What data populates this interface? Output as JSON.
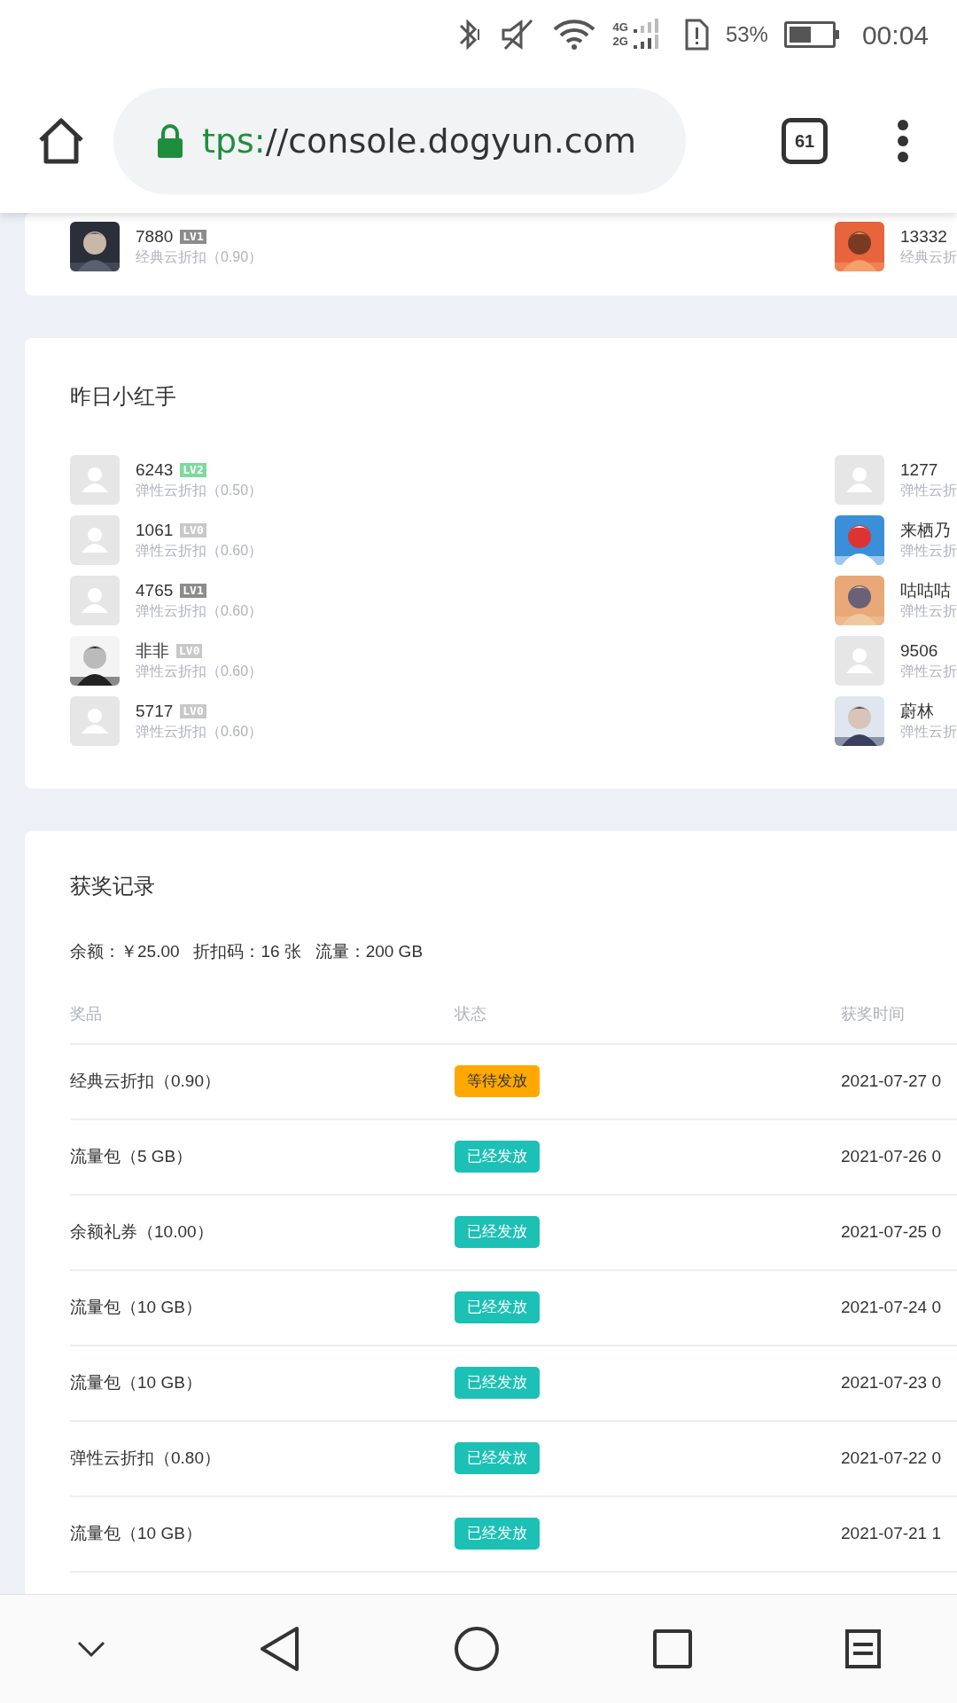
{
  "status_bar": {
    "network_top": "4G",
    "network_bottom": "2G",
    "battery": "53%",
    "time": "00:04"
  },
  "browser": {
    "url_scheme": "tps:",
    "url_rest": "//console.dogyun.com",
    "tab_count": "61"
  },
  "top_card": {
    "left": {
      "name": "7880",
      "badge": "LV1",
      "color": "#8c8c8c",
      "discount": "经典云折扣（0.90）",
      "kind": "picture"
    },
    "right": {
      "name": "13332",
      "discount": "经典云折",
      "kind": "picture"
    }
  },
  "helpers": {
    "title": "昨日小红手",
    "left_column": [
      {
        "name": "6243",
        "badge": "LV2",
        "color": "#7ed8a0",
        "discount": "弹性云折扣（0.50）",
        "kind": "default"
      },
      {
        "name": "1061",
        "badge": "LV0",
        "color": "#c8c8c8",
        "discount": "弹性云折扣（0.60）",
        "kind": "default"
      },
      {
        "name": "4765",
        "badge": "LV1",
        "color": "#8c8c8c",
        "discount": "弹性云折扣（0.60）",
        "kind": "default"
      },
      {
        "name": "非非",
        "badge": "LV0",
        "color": "#c8c8c8",
        "discount": "弹性云折扣（0.60）",
        "kind": "picture"
      },
      {
        "name": "5717",
        "badge": "LV0",
        "color": "#c8c8c8",
        "discount": "弹性云折扣（0.60）",
        "kind": "default"
      }
    ],
    "right_column": [
      {
        "name": "1277",
        "discount": "弹性云折",
        "kind": "default"
      },
      {
        "name": "来栖乃",
        "discount": "弹性云折",
        "kind": "picture"
      },
      {
        "name": "咕咕咕",
        "discount": "弹性云折",
        "kind": "picture"
      },
      {
        "name": "9506",
        "discount": "弹性云折",
        "kind": "default"
      },
      {
        "name": "蔚林",
        "discount": "弹性云折",
        "kind": "picture"
      }
    ]
  },
  "records": {
    "title": "获奖记录",
    "summary": "余额：￥25.00   折扣码：16 张   流量：200 GB",
    "columns": [
      "奖品",
      "状态",
      "获奖时间"
    ],
    "rows": [
      {
        "prize": "经典云折扣（0.90）",
        "status": "等待发放",
        "kind": "pending",
        "time": "2021-07-27 0"
      },
      {
        "prize": "流量包（5 GB）",
        "status": "已经发放",
        "kind": "done",
        "time": "2021-07-26 0"
      },
      {
        "prize": "余额礼券（10.00）",
        "status": "已经发放",
        "kind": "done",
        "time": "2021-07-25 0"
      },
      {
        "prize": "流量包（10 GB）",
        "status": "已经发放",
        "kind": "done",
        "time": "2021-07-24 0"
      },
      {
        "prize": "流量包（10 GB）",
        "status": "已经发放",
        "kind": "done",
        "time": "2021-07-23 0"
      },
      {
        "prize": "弹性云折扣（0.80）",
        "status": "已经发放",
        "kind": "done",
        "time": "2021-07-22 0"
      },
      {
        "prize": "流量包（10 GB）",
        "status": "已经发放",
        "kind": "done",
        "time": "2021-07-21 1"
      }
    ]
  }
}
